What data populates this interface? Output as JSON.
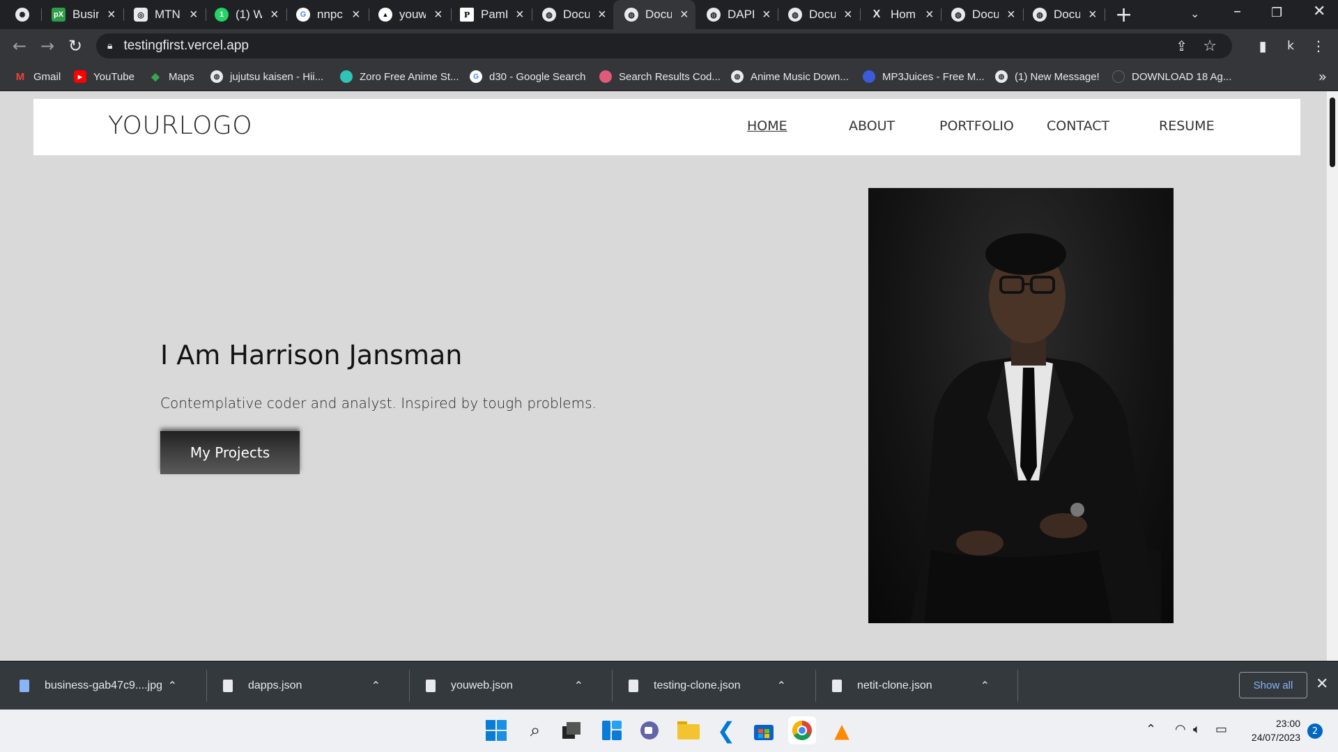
{
  "browser": {
    "tabs": [
      {
        "title": "",
        "favicon": "openai-icon"
      },
      {
        "title": "Busin",
        "favicon": "px-icon",
        "badge": "pX"
      },
      {
        "title": "MTN",
        "favicon": "mtn-icon"
      },
      {
        "title": "(1) W",
        "favicon": "whatsapp-icon",
        "badge": "1"
      },
      {
        "title": "nnpc",
        "favicon": "google-icon",
        "badge": "G"
      },
      {
        "title": "youw",
        "favicon": "vercel-icon",
        "badge": "▲"
      },
      {
        "title": "PamD",
        "favicon": "p-icon",
        "badge": "P"
      },
      {
        "title": "Docu",
        "favicon": "globe-icon"
      },
      {
        "title": "Docu",
        "favicon": "globe-icon"
      },
      {
        "title": "DAPP",
        "favicon": "globe-icon"
      },
      {
        "title": "Docu",
        "favicon": "globe-icon"
      },
      {
        "title": "Hom",
        "favicon": "x-icon",
        "badge": "X"
      },
      {
        "title": "Docu",
        "favicon": "globe-icon"
      },
      {
        "title": "Docu",
        "favicon": "globe-icon"
      }
    ],
    "active_tab_index": 8,
    "url": "testingfirst.vercel.app",
    "profile_initial": "k",
    "bookmarks": [
      {
        "label": "Gmail",
        "icon": "gmail-icon",
        "badge": "M",
        "color": "#ea4335"
      },
      {
        "label": "YouTube",
        "icon": "youtube-icon",
        "badge": "▶",
        "color": "#ff0000"
      },
      {
        "label": "Maps",
        "icon": "maps-icon",
        "badge": "◆",
        "color": "#34a853"
      },
      {
        "label": "jujutsu kaisen - Hii...",
        "icon": "globe-icon",
        "badge": "",
        "color": "#e8eaed"
      },
      {
        "label": "Zoro Free Anime St...",
        "icon": "zoro-icon",
        "badge": "",
        "color": "#2ec4b6"
      },
      {
        "label": "d30 - Google Search",
        "icon": "google-icon",
        "badge": "G",
        "color": "#4285f4"
      },
      {
        "label": "Search Results Cod...",
        "icon": "search-results-icon",
        "badge": "",
        "color": "#e05a7a"
      },
      {
        "label": "Anime Music Down...",
        "icon": "globe-icon",
        "badge": "",
        "color": "#e8eaed"
      },
      {
        "label": "MP3Juices - Free M...",
        "icon": "mp3juices-icon",
        "badge": "",
        "color": "#3b5bdb"
      },
      {
        "label": "(1) New Message!",
        "icon": "globe-icon",
        "badge": "",
        "color": "#e8eaed"
      },
      {
        "label": "DOWNLOAD 18 Ag...",
        "icon": "download-site-icon",
        "badge": "",
        "color": "#5f6368"
      }
    ]
  },
  "site": {
    "logo": "YOURLOGO",
    "nav": [
      "HOME",
      "ABOUT",
      "PORTFOLIO",
      "CONTACT",
      "RESUME"
    ],
    "active_nav": "HOME",
    "hero_title": "I Am Harrison Jansman",
    "hero_subtitle": "Contemplative coder and analyst. Inspired by tough problems.",
    "hero_button": "My Projects",
    "portrait_alt": "portrait-photo"
  },
  "downloads": {
    "items": [
      "business-gab47c9....jpg",
      "dapps.json",
      "youweb.json",
      "testing-clone.json",
      "netit-clone.json"
    ],
    "show_all": "Show all"
  },
  "taskbar": {
    "time": "23:00",
    "date": "24/07/2023",
    "notifications": "2"
  }
}
